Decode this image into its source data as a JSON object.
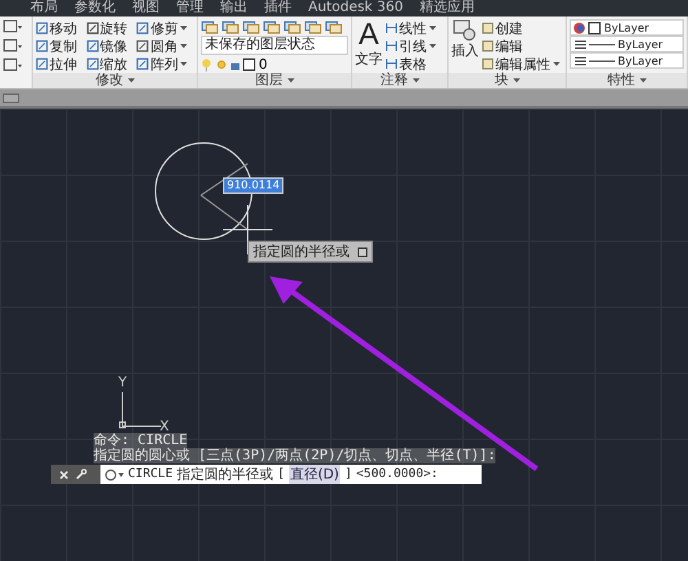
{
  "tabs": [
    {
      "label": "布局"
    },
    {
      "label": "参数化"
    },
    {
      "label": "视图"
    },
    {
      "label": "管理"
    },
    {
      "label": "输出"
    },
    {
      "label": "插件"
    },
    {
      "label": "Autodesk 360"
    },
    {
      "label": "精选应用"
    }
  ],
  "modify_panel": {
    "title": "修改",
    "tools": [
      {
        "label": "移动",
        "has_menu": false
      },
      {
        "label": "旋转",
        "has_menu": false
      },
      {
        "label": "修剪",
        "has_menu": true
      },
      {
        "label": "复制",
        "has_menu": false
      },
      {
        "label": "镜像",
        "has_menu": false
      },
      {
        "label": "圆角",
        "has_menu": true
      },
      {
        "label": "拉伸",
        "has_menu": false
      },
      {
        "label": "缩放",
        "has_menu": false
      },
      {
        "label": "阵列",
        "has_menu": true
      }
    ]
  },
  "layers_panel": {
    "title": "图层",
    "layer_state": "未保存的图层状态",
    "current_layer": "0"
  },
  "annotation_panel": {
    "title": "注释",
    "text_glyph": "A",
    "text_tool": "文字",
    "tools": [
      {
        "label": "线性",
        "has_menu": true
      },
      {
        "label": "引线",
        "has_menu": true
      },
      {
        "label": "表格",
        "has_menu": false
      }
    ]
  },
  "block_panel": {
    "title": "块",
    "insert_tool": "插入",
    "tools": [
      {
        "label": "创建",
        "has_menu": false
      },
      {
        "label": "编辑",
        "has_menu": false
      },
      {
        "label": "编辑属性",
        "has_menu": true
      }
    ]
  },
  "properties_panel": {
    "title": "特性",
    "rows": [
      "ByLayer",
      "ByLayer",
      "ByLayer"
    ]
  },
  "drawing": {
    "radius_input": "910.0114",
    "tooltip": "指定圆的半径或",
    "axis_labels": [
      "Y",
      "X"
    ]
  },
  "command_history": [
    "命令: CIRCLE",
    "指定圆的圆心或 [三点(3P)/两点(2P)/切点、切点、半径(T)]:"
  ],
  "command_line": {
    "command": "CIRCLE",
    "prompt": "指定圆的半径或",
    "brackets": [
      "[",
      "]"
    ],
    "option": "直径(D)",
    "default": "<500.0000>:"
  }
}
